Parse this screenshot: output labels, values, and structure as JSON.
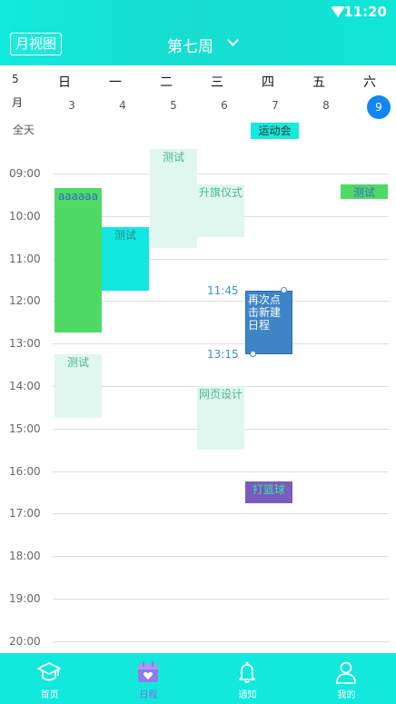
{
  "status_bar": {
    "time": "11:20"
  },
  "header": {
    "month_view_label": "月视图",
    "week_title": "第七周"
  },
  "week": {
    "month": "5\n月",
    "weekdays": [
      "日",
      "一",
      "二",
      "三",
      "四",
      "五",
      "六"
    ],
    "dates": [
      "3",
      "4",
      "5",
      "6",
      "7",
      "8",
      "9"
    ],
    "today": "9"
  },
  "all_day": {
    "label": "全天",
    "event": "运动会"
  },
  "hours": [
    "09:00",
    "10:00",
    "11:00",
    "12:00",
    "13:00",
    "14:00",
    "15:00",
    "16:00",
    "17:00",
    "18:00",
    "19:00",
    "20:00"
  ],
  "events": [
    {
      "id": "e1",
      "title": "aaaaaa",
      "day": "日",
      "start": "09:20",
      "end": "12:45",
      "color": "#4fd965",
      "text_color": "#2e6bd1"
    },
    {
      "id": "e2",
      "title": "测试",
      "day": "一",
      "start": "10:15",
      "end": "11:45",
      "color": "#10e8e0",
      "text_color": "#2c8b8a"
    },
    {
      "id": "e3",
      "title": "测试",
      "day": "二",
      "start": "08:25",
      "end": "10:45",
      "color": "#dff7ee",
      "text_color": "#4ab494"
    },
    {
      "id": "e4",
      "title": "升旗仪式",
      "day": "三",
      "start": "09:15",
      "end": "10:30",
      "color": "#dff7ee",
      "text_color": "#4ab494"
    },
    {
      "id": "e5",
      "title": "测试",
      "day": "六",
      "start": "09:15",
      "end": "09:35",
      "color": "#4fd965",
      "text_color": "#2e6bd1"
    },
    {
      "id": "e6",
      "title": "再次点击新建日程",
      "day": "四",
      "start": "11:45",
      "end": "13:15",
      "color": "#3e84c6",
      "text_color": "#ffffff",
      "selected": true
    },
    {
      "id": "e7",
      "title": "测试",
      "day": "日",
      "start": "13:15",
      "end": "14:45",
      "color": "#dff7ee",
      "text_color": "#4ab494"
    },
    {
      "id": "e8",
      "title": "网页设计",
      "day": "三",
      "start": "14:00",
      "end": "15:30",
      "color": "#dff7ee",
      "text_color": "#4ab494"
    },
    {
      "id": "e9",
      "title": "打篮球",
      "day": "四",
      "start": "16:15",
      "end": "16:45",
      "color": "#7a5bbf",
      "text_color": "#33e59b"
    }
  ],
  "selection": {
    "start_label": "11:45",
    "end_label": "13:15"
  },
  "tabs": [
    {
      "label": "首页",
      "icon": "graduation-cap-icon",
      "active": false
    },
    {
      "label": "日程",
      "icon": "calendar-icon",
      "active": true
    },
    {
      "label": "通知",
      "icon": "bell-icon",
      "active": false
    },
    {
      "label": "我的",
      "icon": "person-icon",
      "active": false
    }
  ],
  "colors": {
    "header": "#12e9dc",
    "today": "#0f86f2",
    "active_tab": "#7e6cdd",
    "grid_line": "#dedede"
  }
}
